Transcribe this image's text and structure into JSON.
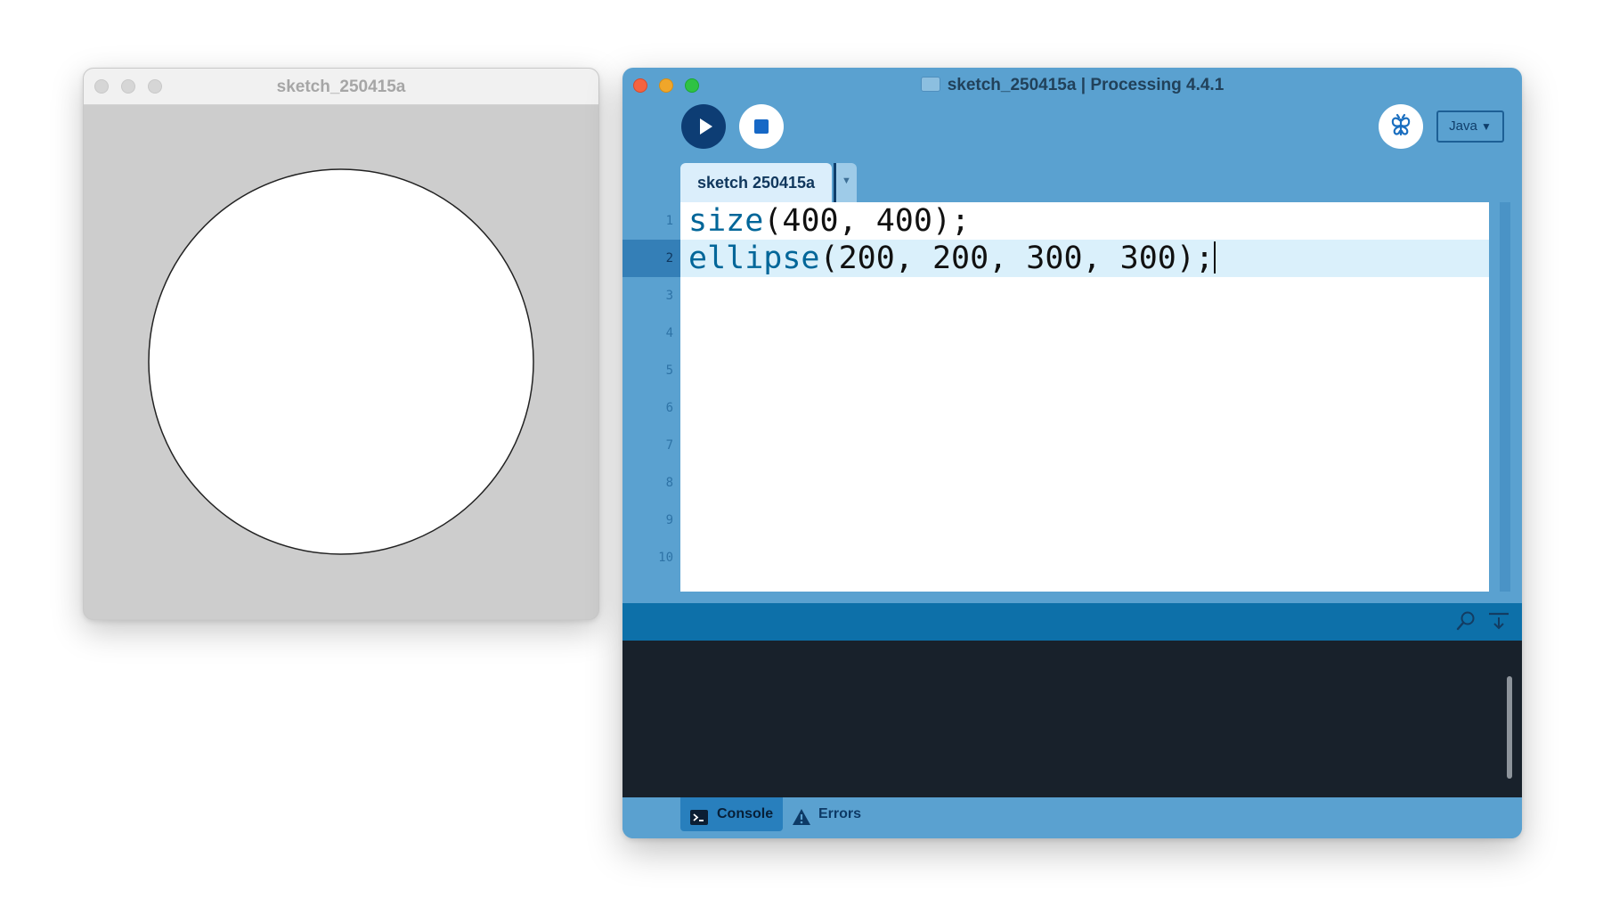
{
  "sketch_window": {
    "title": "sketch_250415a",
    "canvas": {
      "background": "#cdcdcd",
      "shape": "ellipse",
      "fill": "#ffffff",
      "stroke": "#222222"
    }
  },
  "ide": {
    "title": "sketch_250415a | Processing 4.4.1",
    "traffic_colors": {
      "close": "#fe5f57",
      "minimize": "#febc2e",
      "zoom": "#28c840"
    },
    "toolbar": {
      "run_icon": "play-icon",
      "stop_icon": "stop-icon",
      "debug_icon": "butterfly-icon",
      "mode_label": "Java",
      "mode_icon": "caret-down-icon"
    },
    "tab": {
      "label": "sketch 250415a",
      "menu_glyph": "▼"
    },
    "editor": {
      "current_line": 2,
      "line_numbers": [
        "1",
        "2",
        "3",
        "4",
        "5",
        "6",
        "7",
        "8",
        "9",
        "10"
      ],
      "lines": [
        {
          "fn": "size",
          "args": "(400, 400);"
        },
        {
          "fn": "ellipse",
          "args": "(200, 200, 300, 300);"
        }
      ]
    },
    "console_tools": [
      "find-icon",
      "clear-console-icon"
    ],
    "footer": {
      "console_label": "Console",
      "errors_label": "Errors"
    },
    "colors": {
      "accent": "#5aa1d0",
      "run_button": "#0d3d74",
      "keyword": "#006699",
      "console_bg": "#18212b",
      "console_bar": "#0d70a9"
    }
  }
}
